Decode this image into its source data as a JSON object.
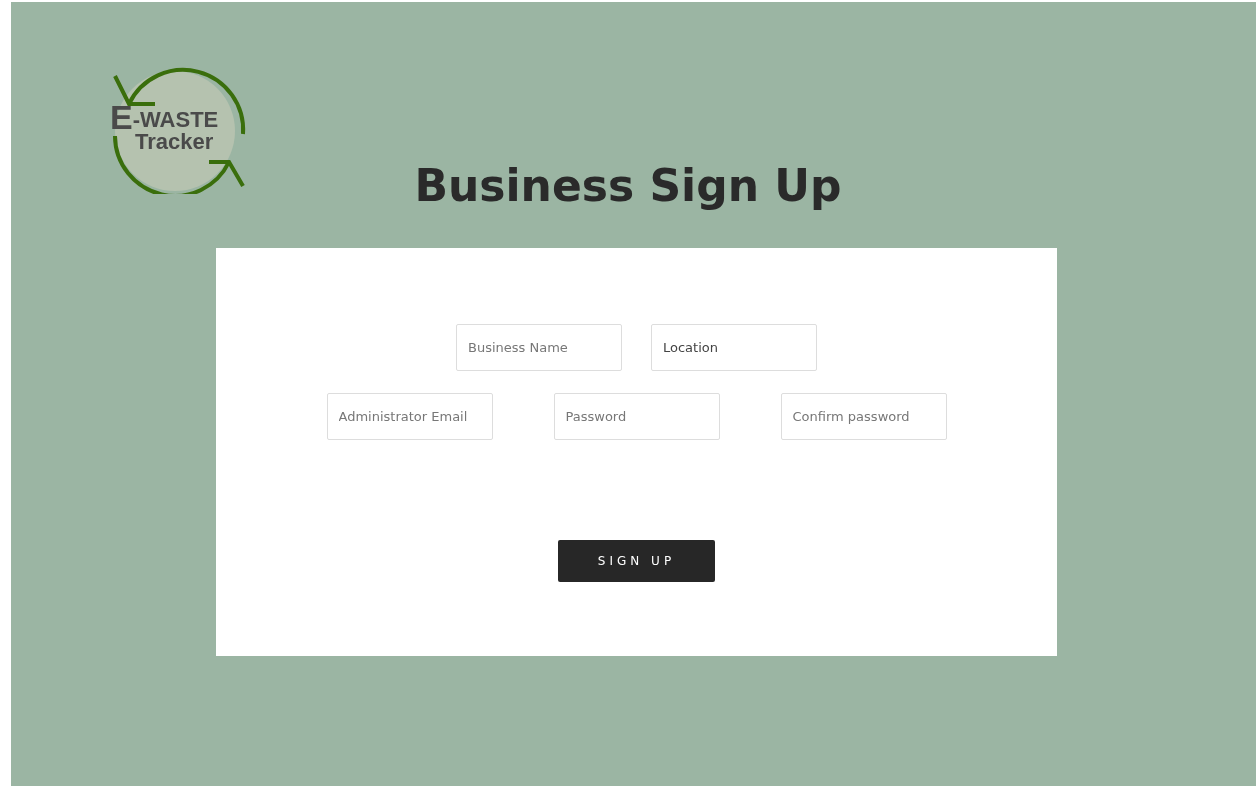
{
  "logo": {
    "initial": "E",
    "line1": "-WASTE",
    "line2": "Tracker"
  },
  "title": "Business Sign Up",
  "rows": [
    [
      {
        "placeholder": "Business Name"
      },
      {
        "value": "Location"
      }
    ],
    [
      {
        "placeholder": "Administrator Email"
      },
      {
        "placeholder": "Password"
      },
      {
        "placeholder": "Confirm password"
      }
    ]
  ],
  "button": "SIGN UP"
}
